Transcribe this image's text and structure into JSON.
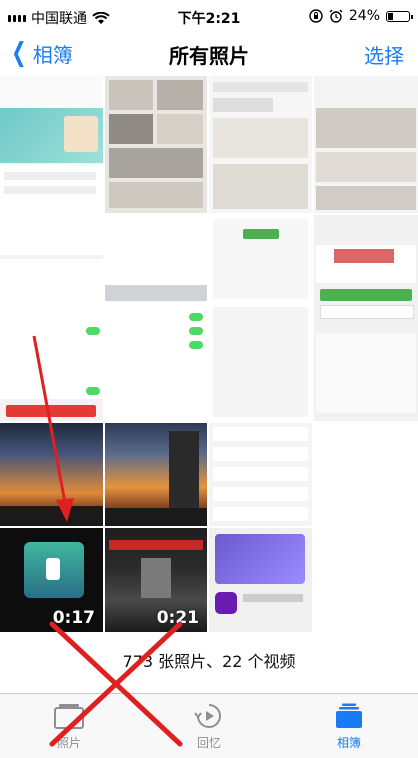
{
  "status": {
    "carrier": "中国联通",
    "time": "下午2:21",
    "battery": "24%",
    "battery_level": 0.24
  },
  "nav": {
    "back_label": "相簿",
    "title": "所有照片",
    "select_label": "选择"
  },
  "grid": {
    "videos": [
      {
        "duration": "0:17"
      },
      {
        "duration": "0:21"
      }
    ]
  },
  "footer": {
    "count_text": "773 张照片、22 个视频"
  },
  "tabs": [
    {
      "label": "照片",
      "active": false
    },
    {
      "label": "回忆",
      "active": false
    },
    {
      "label": "相簿",
      "active": true
    }
  ],
  "colors": {
    "accent": "#1a7cf5",
    "tab_inactive": "#8e8e93",
    "annotation": "#e02020"
  }
}
